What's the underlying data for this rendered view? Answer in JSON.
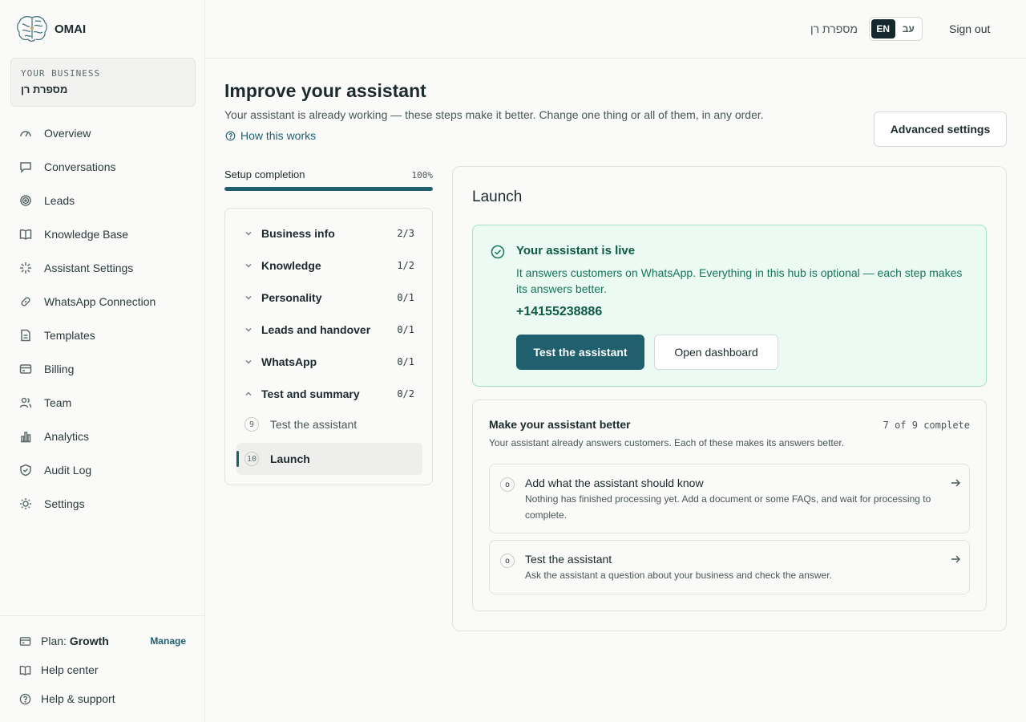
{
  "brand": {
    "name": "OMAI"
  },
  "business": {
    "label": "YOUR BUSINESS",
    "name": "מספרת רן"
  },
  "nav": [
    {
      "label": "Overview",
      "icon": "gauge-icon"
    },
    {
      "label": "Conversations",
      "icon": "chat-bubble-icon"
    },
    {
      "label": "Leads",
      "icon": "target-icon"
    },
    {
      "label": "Knowledge Base",
      "icon": "book-icon"
    },
    {
      "label": "Assistant Settings",
      "icon": "sparkle-icon"
    },
    {
      "label": "WhatsApp Connection",
      "icon": "link-icon"
    },
    {
      "label": "Templates",
      "icon": "document-icon"
    },
    {
      "label": "Billing",
      "icon": "credit-card-icon"
    },
    {
      "label": "Team",
      "icon": "users-icon"
    },
    {
      "label": "Analytics",
      "icon": "bar-chart-icon"
    },
    {
      "label": "Audit Log",
      "icon": "shield-icon"
    },
    {
      "label": "Settings",
      "icon": "sun-gear-icon"
    }
  ],
  "sidebar_bottom": {
    "plan_label": "Plan:",
    "plan_value": "Growth",
    "manage": "Manage",
    "help_center": "Help center",
    "help_support": "Help & support"
  },
  "topbar": {
    "business_name": "מספרת רן",
    "lang_en": "EN",
    "lang_he": "עב",
    "sign_out": "Sign out"
  },
  "header": {
    "title": "Improve your assistant",
    "subtitle": "Your assistant is already working — these steps make it better. Change one thing or all of them, in any order.",
    "how_link": "How this works",
    "advanced_button": "Advanced settings"
  },
  "progress": {
    "label": "Setup completion",
    "percent_label": "100%",
    "value": 1.0
  },
  "steps": [
    {
      "name": "Business info",
      "count": "2/3",
      "expanded": false
    },
    {
      "name": "Knowledge",
      "count": "1/2",
      "expanded": false
    },
    {
      "name": "Personality",
      "count": "0/1",
      "expanded": false
    },
    {
      "name": "Leads and handover",
      "count": "0/1",
      "expanded": false
    },
    {
      "name": "WhatsApp",
      "count": "0/1",
      "expanded": false
    },
    {
      "name": "Test and summary",
      "count": "0/2",
      "expanded": true
    }
  ],
  "substeps": [
    {
      "num": "9",
      "label": "Test the assistant",
      "active": false
    },
    {
      "num": "10",
      "label": "Launch",
      "active": true
    }
  ],
  "launch": {
    "title": "Launch",
    "live_title": "Your assistant is live",
    "live_text": "It answers customers on WhatsApp. Everything in this hub is optional — each step makes its answers better.",
    "phone": "+14155238886",
    "test_button": "Test the assistant",
    "dashboard_button": "Open dashboard"
  },
  "better": {
    "title": "Make your assistant better",
    "count": "7 of 9 complete",
    "subtitle": "Your assistant already answers customers. Each of these makes its answers better.",
    "tasks": [
      {
        "marker": "o",
        "title": "Add what the assistant should know",
        "desc": "Nothing has finished processing yet. Add a document or some FAQs, and wait for processing to complete."
      },
      {
        "marker": "o",
        "title": "Test the assistant",
        "desc": "Ask the assistant a question about your business and check the answer."
      }
    ]
  },
  "colors": {
    "accent": "#1f5f6e",
    "success_bg": "#ebfaf2",
    "success_text": "#0f5a46"
  }
}
